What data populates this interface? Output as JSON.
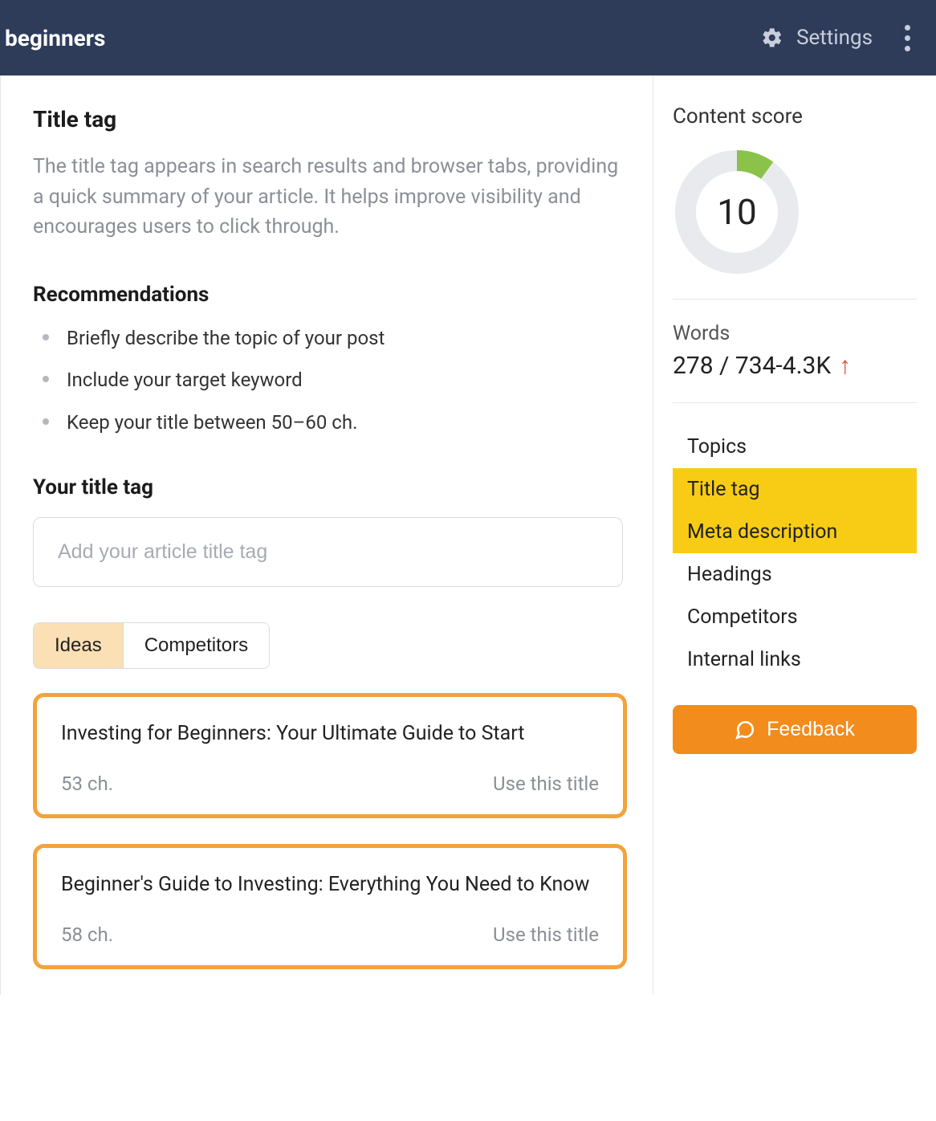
{
  "topbar": {
    "title_fragment": "beginners",
    "settings_label": "Settings"
  },
  "main": {
    "title_tag_heading": "Title tag",
    "title_tag_description": "The title tag appears in search results and browser tabs, providing a quick summary of your article. It helps improve visibility and encourages users to click through.",
    "recommendations_heading": "Recommendations",
    "recommendations": [
      "Briefly describe the topic of your post",
      "Include your target keyword",
      "Keep your title between 50–60 ch."
    ],
    "your_title_heading": "Your title tag",
    "title_input_placeholder": "Add your article title tag",
    "tabs": {
      "ideas": "Ideas",
      "competitors": "Competitors"
    },
    "ideas": [
      {
        "title": "Investing for Beginners: Your Ultimate Guide to Start",
        "ch": "53 ch.",
        "action": "Use this title"
      },
      {
        "title": "Beginner's Guide to Investing: Everything You Need to Know",
        "ch": "58 ch.",
        "action": "Use this title"
      }
    ]
  },
  "side": {
    "content_score_label": "Content score",
    "content_score_value": "10",
    "content_score_pct": 10,
    "words_label": "Words",
    "words_value": "278 / 734-4.3K",
    "nav": [
      {
        "label": "Topics",
        "highlight": false
      },
      {
        "label": "Title tag",
        "highlight": true
      },
      {
        "label": "Meta description",
        "highlight": true
      },
      {
        "label": "Headings",
        "highlight": false
      },
      {
        "label": "Competitors",
        "highlight": false
      },
      {
        "label": "Internal links",
        "highlight": false
      }
    ],
    "feedback_label": "Feedback"
  }
}
